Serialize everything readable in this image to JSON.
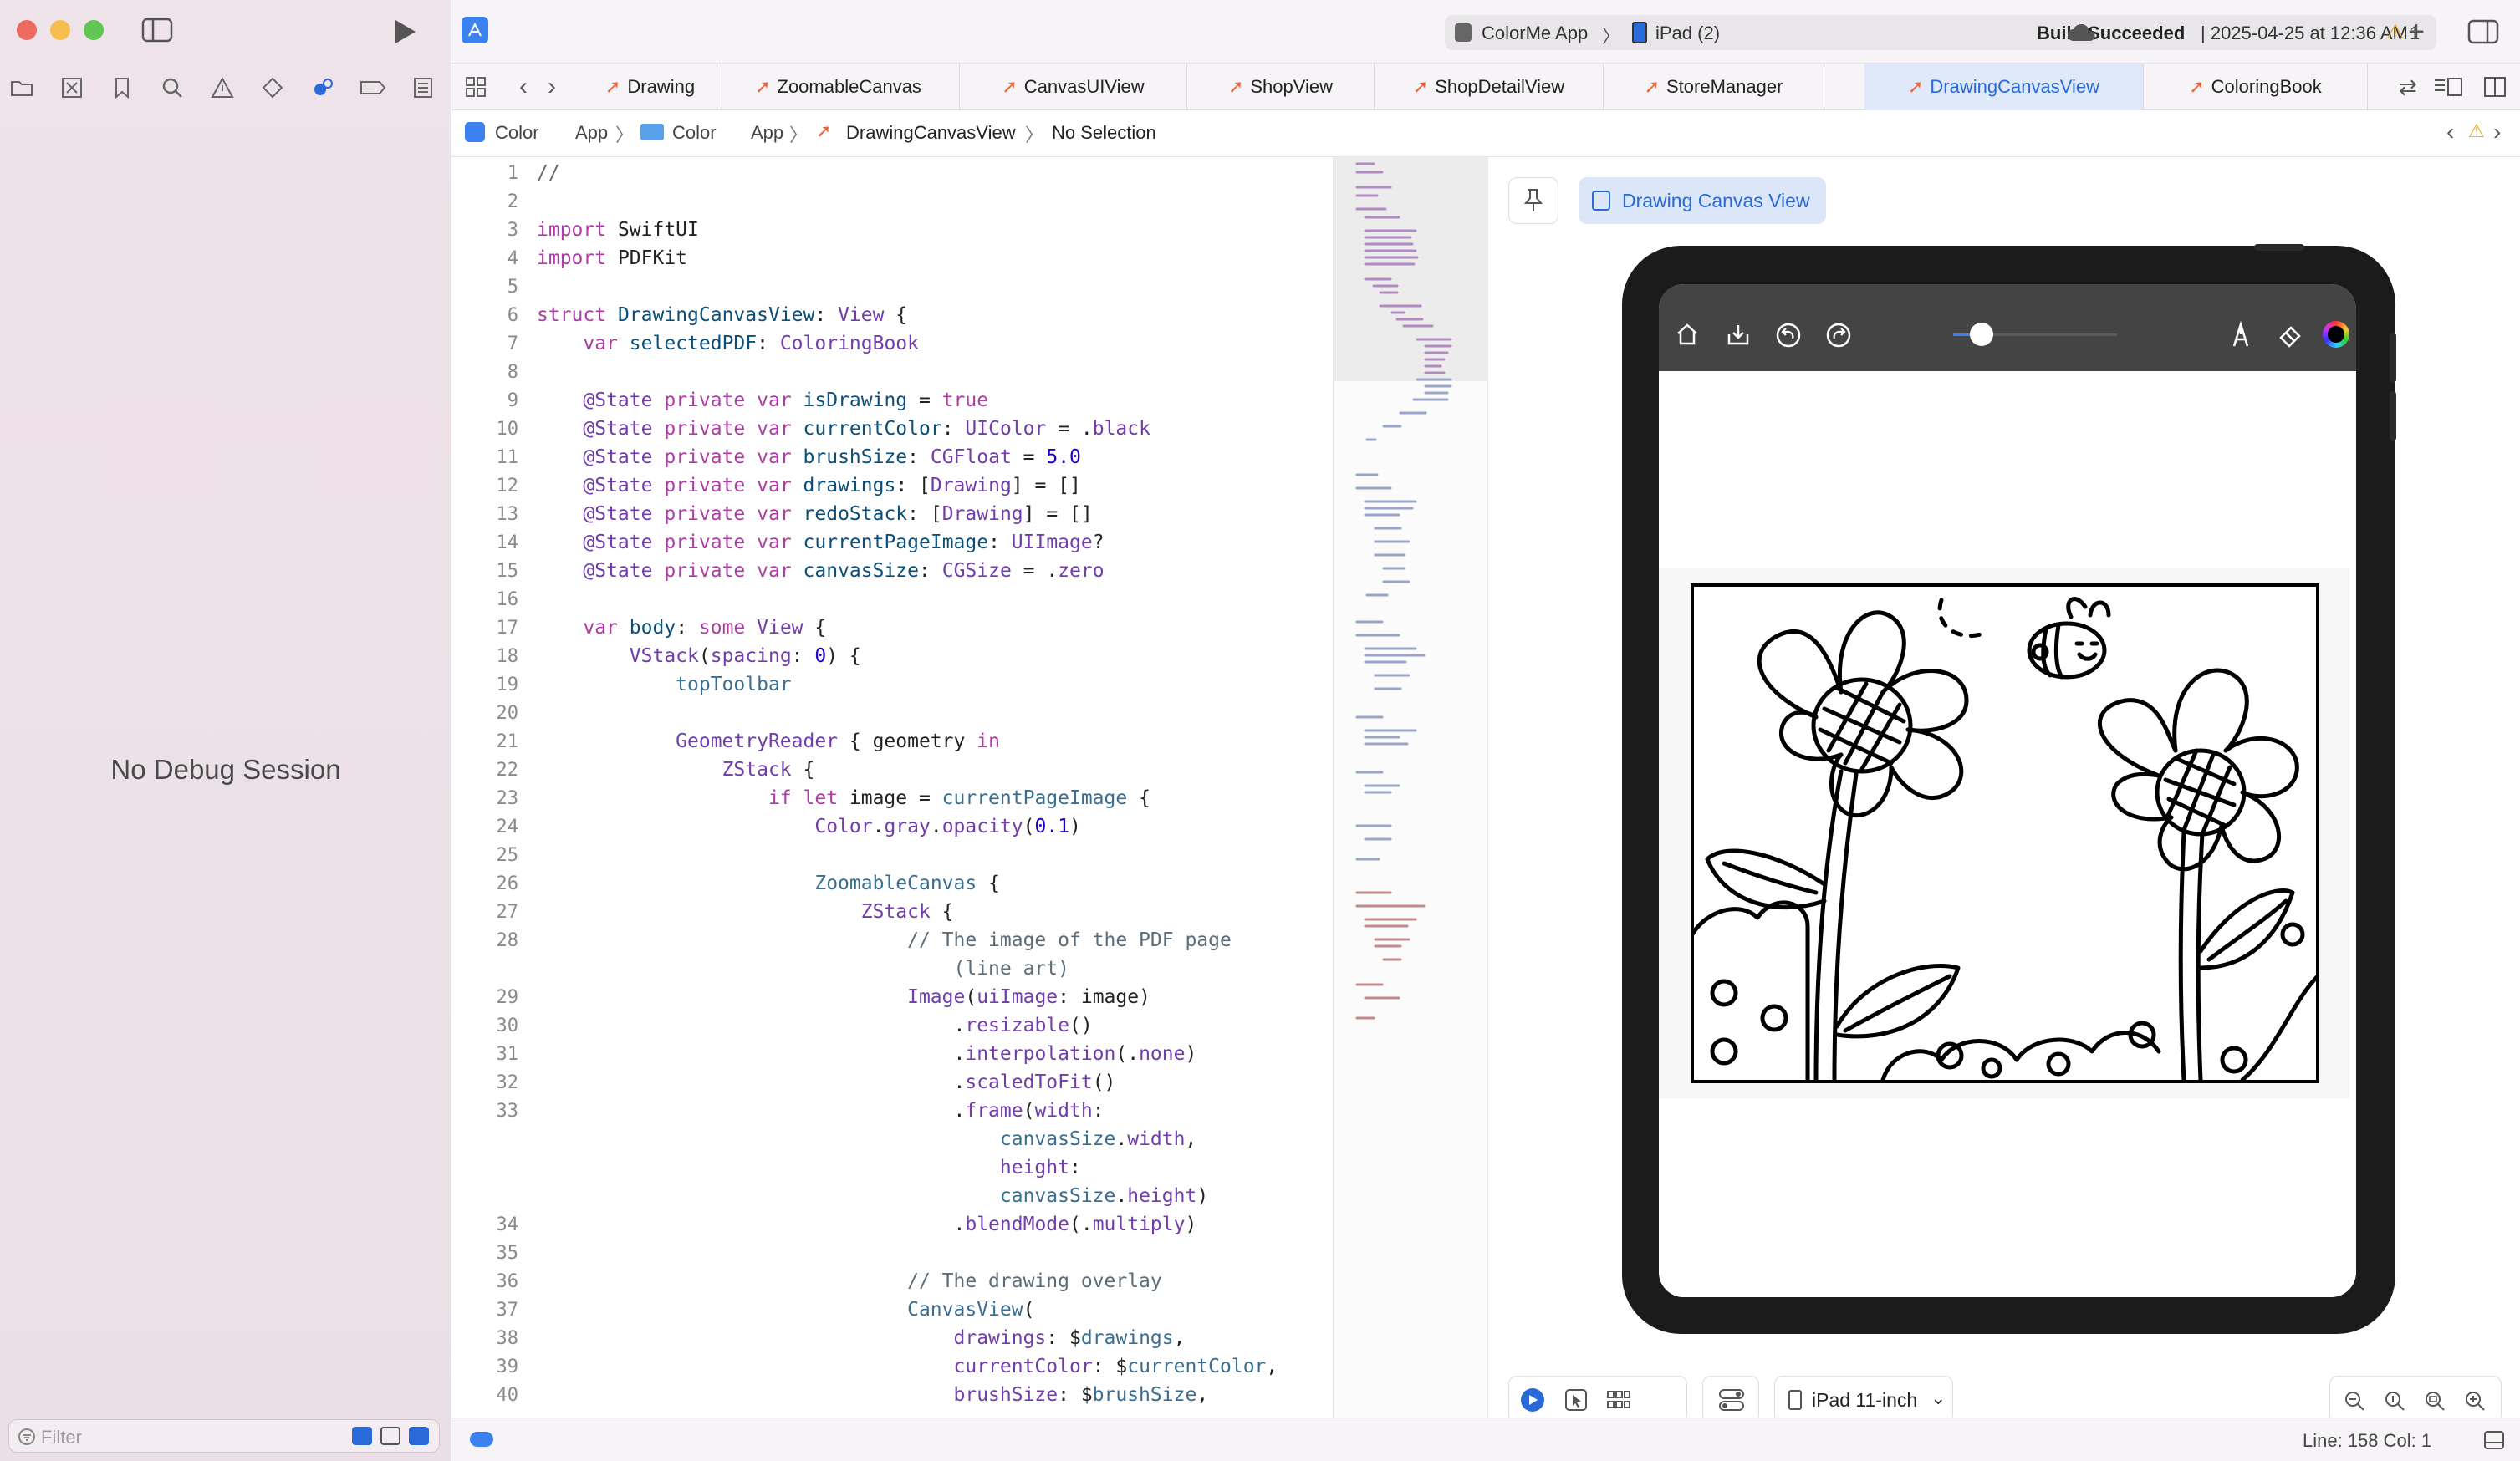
{
  "left_pane": {
    "no_debug": "No Debug Session",
    "filter_placeholder": "Filter"
  },
  "toolbar": {
    "scheme": "ColorMe App",
    "device": "iPad (2)",
    "build_status_bold": "Build Succeeded",
    "build_time": "| 2025-04-25 at 12:36 AM",
    "warning_count": "1"
  },
  "tabs": [
    {
      "label": "Drawing"
    },
    {
      "label": "ZoomableCanvas"
    },
    {
      "label": "CanvasUIView"
    },
    {
      "label": "ShopView"
    },
    {
      "label": "ShopDetailView"
    },
    {
      "label": "StoreManager"
    },
    {
      "label": "DrawingCanvasView"
    },
    {
      "label": "ColoringBook"
    }
  ],
  "breadcrumb": {
    "project_a": "Color",
    "project_b": "App",
    "folder_a": "Color",
    "folder_b": "App",
    "file": "DrawingCanvasView",
    "selection": "No Selection"
  },
  "code": {
    "line_numbers": [
      "1",
      "2",
      "3",
      "4",
      "5",
      "6",
      "7",
      "8",
      "9",
      "10",
      "11",
      "12",
      "13",
      "14",
      "15",
      "16",
      "17",
      "18",
      "19",
      "20",
      "21",
      "22",
      "23",
      "24",
      "25",
      "26",
      "27",
      "28",
      "",
      "29",
      "30",
      "31",
      "32",
      "33",
      "",
      "",
      "",
      "34",
      "35",
      "36",
      "37",
      "38",
      "39",
      "40"
    ]
  },
  "preview": {
    "tab_label": "Drawing Canvas View",
    "device_selector": "iPad 11-inch"
  },
  "status": {
    "line_col": "Line: 158  Col: 1"
  }
}
